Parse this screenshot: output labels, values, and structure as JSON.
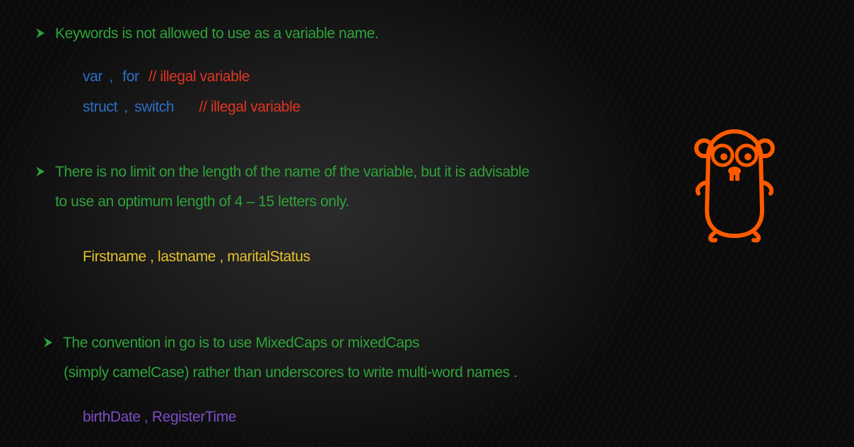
{
  "section1": {
    "heading": "Keywords is not allowed to use as a variable name.",
    "line1": {
      "kw1": "var",
      "sep": ",",
      "kw2": "for",
      "comment": "// illegal variable"
    },
    "line2": {
      "kw1": "struct",
      "sep": ",",
      "kw2": "switch",
      "comment": "// illegal variable"
    }
  },
  "section2": {
    "line1": "There is no limit on the length of the name of the variable, but it is advisable",
    "line2": "to use an optimum length of 4 – 15 letters only.",
    "example": "Firstname , lastname , maritalStatus"
  },
  "section3": {
    "line1": "The convention in go is to use MixedCaps or mixedCaps",
    "line2": "(simply camelCase) rather than underscores to write multi-word names .",
    "example": "birthDate , RegisterTime"
  },
  "colors": {
    "bullet_text": "#2fa33a",
    "keyword": "#2f6fc4",
    "comment": "#e23422",
    "example_yellow": "#e3c02c",
    "example_purple": "#7c4ec4",
    "gopher": "#ff5a00"
  },
  "icons": {
    "bullet": "arrowhead-bullet-icon",
    "mascot": "go-gopher-icon"
  }
}
